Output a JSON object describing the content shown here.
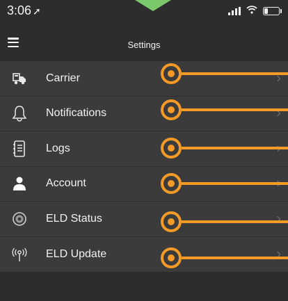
{
  "status_bar": {
    "time": "3:06",
    "location_icon": "location-arrow-icon",
    "signal_icon": "cellular-signal-icon",
    "wifi_icon": "wifi-icon",
    "battery_icon": "battery-low-icon"
  },
  "header": {
    "title": "Settings",
    "menu_icon": "hamburger-menu-icon"
  },
  "menu": {
    "items": [
      {
        "label": "Carrier",
        "icon": "truck-icon"
      },
      {
        "label": "Notifications",
        "icon": "bell-icon"
      },
      {
        "label": "Logs",
        "icon": "logbook-icon"
      },
      {
        "label": "Account",
        "icon": "person-icon"
      },
      {
        "label": "ELD Status",
        "icon": "eld-status-icon"
      },
      {
        "label": "ELD Update",
        "icon": "antenna-signal-icon"
      }
    ],
    "chevron": "›"
  },
  "colors": {
    "background": "#2d2d2d",
    "menu_background": "#3b3b3b",
    "callout_orange": "#f39a27",
    "pointer_green": "#7bc86c"
  }
}
